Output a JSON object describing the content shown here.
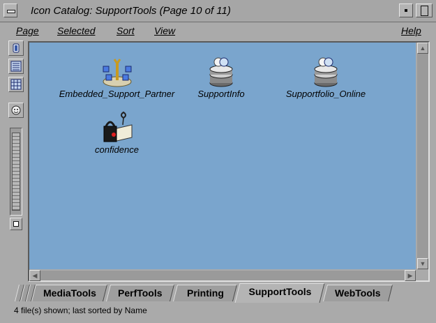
{
  "window": {
    "title": "Icon Catalog: SupportTools (Page 10 of 11)"
  },
  "menubar": {
    "items": [
      {
        "label": "Page"
      },
      {
        "label": "Selected"
      },
      {
        "label": "Sort"
      },
      {
        "label": "View"
      },
      {
        "label": "Help"
      }
    ]
  },
  "toolbar": {
    "buttons": [
      {
        "icon": "large-icon-view-icon"
      },
      {
        "icon": "list-view-icon"
      },
      {
        "icon": "column-view-icon"
      },
      {
        "icon": "face-icon"
      }
    ]
  },
  "catalog": {
    "background": "#7aa5cd",
    "icons": [
      {
        "label": "Embedded_Support_Partner",
        "icon": "embedded-support-partner-icon"
      },
      {
        "label": "SupportInfo",
        "icon": "supportinfo-icon"
      },
      {
        "label": "Supportfolio_Online",
        "icon": "supportfolio-online-icon"
      },
      {
        "label": "confidence",
        "icon": "confidence-icon"
      }
    ]
  },
  "tabs": [
    {
      "label": "MediaTools",
      "active": false
    },
    {
      "label": "PerfTools",
      "active": false
    },
    {
      "label": "Printing",
      "active": false
    },
    {
      "label": "SupportTools",
      "active": true
    },
    {
      "label": "WebTools",
      "active": false
    }
  ],
  "status": {
    "text": "4 file(s) shown; last sorted by Name"
  }
}
